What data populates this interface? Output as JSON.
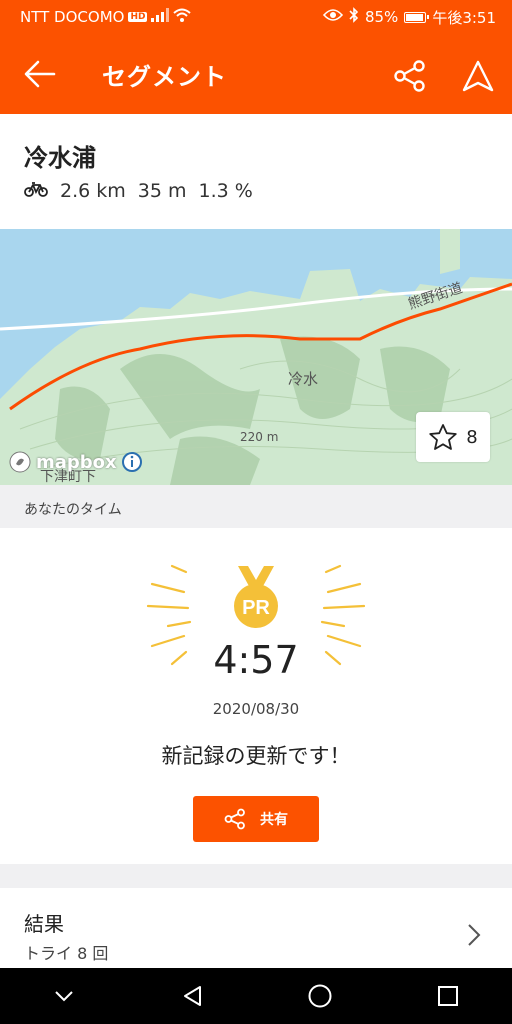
{
  "status_bar": {
    "carrier": "NTT DOCOMO",
    "hd": "HD",
    "battery_text": "85%",
    "battery_level": 0.85,
    "time": "午後3:51"
  },
  "app_bar": {
    "title": "セグメント"
  },
  "segment": {
    "name": "冷水浦",
    "distance": "2.6 km",
    "elevation": "35 m",
    "grade": "1.3 %"
  },
  "map": {
    "label_road": "熊野街道",
    "label_place": "冷水",
    "label_contour": "220 m",
    "label_town": "下津町下",
    "attribution": "mapbox",
    "star_count": "8",
    "route_color": "#fc4c02"
  },
  "your_time": {
    "label": "あなたのタイム"
  },
  "pr": {
    "badge": "PR",
    "time": "4:57",
    "date": "2020/08/30",
    "message": "新記録の更新です！",
    "share_label": "共有"
  },
  "results": {
    "title": "結果",
    "subtitle": "トライ 8 回"
  },
  "colors": {
    "brand": "#fc5200",
    "medal": "#f4c038"
  }
}
